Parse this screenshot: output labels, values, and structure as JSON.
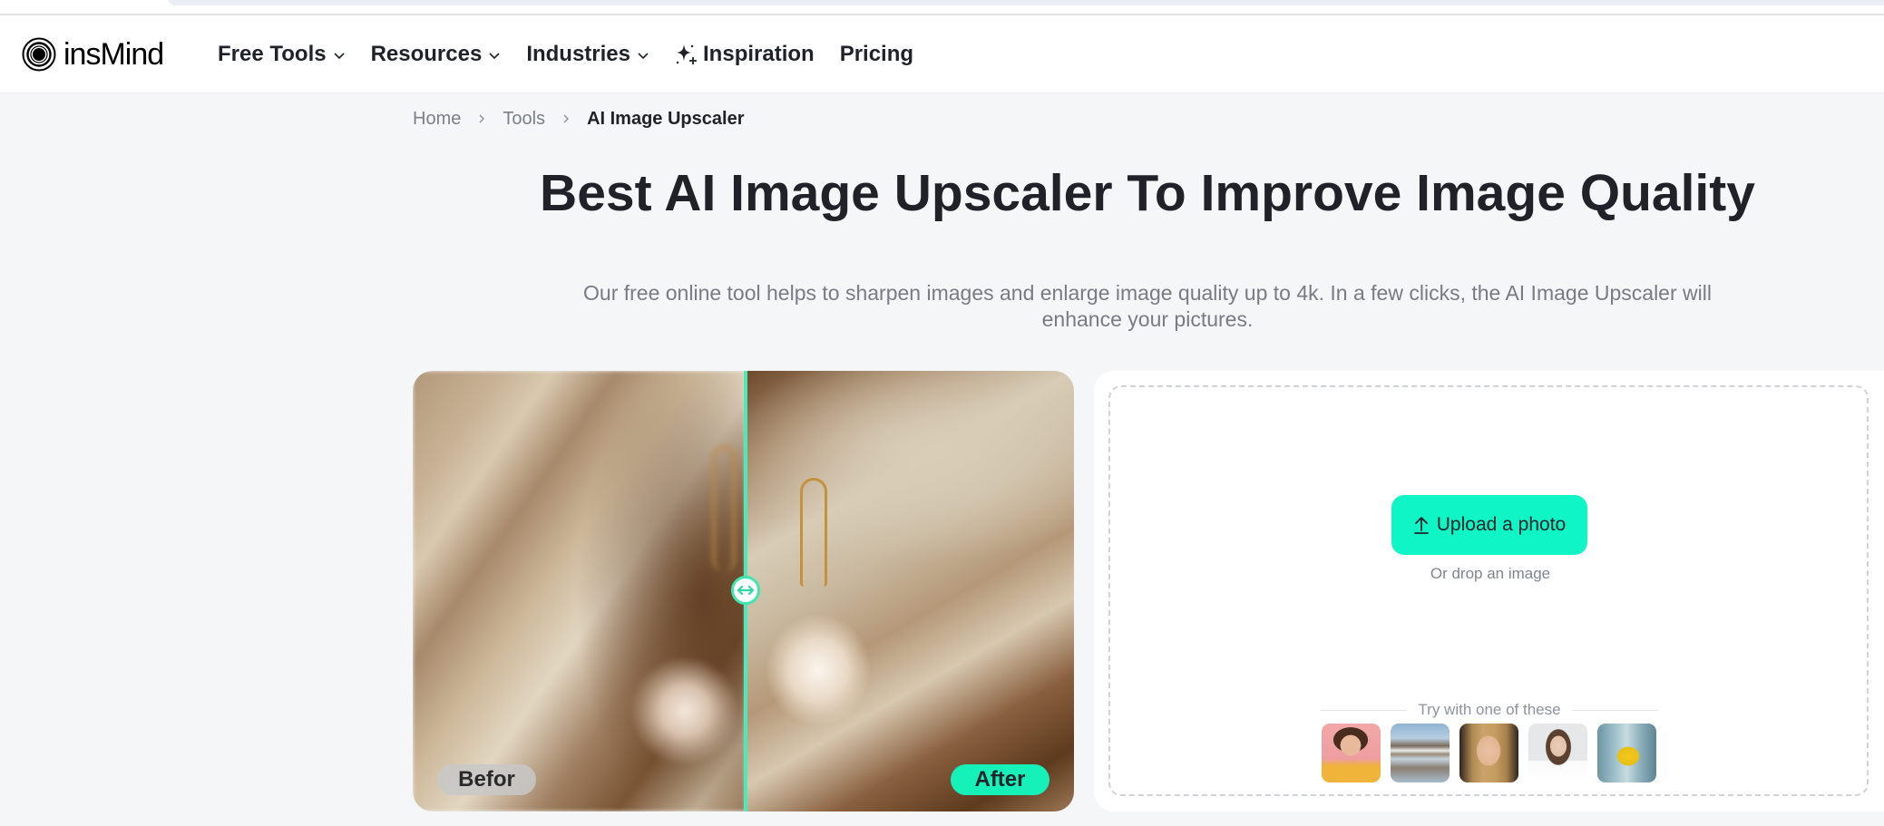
{
  "header": {
    "logo_text": "insMind",
    "nav": [
      {
        "label": "Free Tools",
        "has_dropdown": true
      },
      {
        "label": "Resources",
        "has_dropdown": true
      },
      {
        "label": "Industries",
        "has_dropdown": true
      },
      {
        "label": "Inspiration",
        "icon": "sparkle-icon"
      },
      {
        "label": "Pricing"
      }
    ]
  },
  "breadcrumb": {
    "items": [
      "Home",
      "Tools"
    ],
    "current": "AI Image Upscaler"
  },
  "hero": {
    "title": "Best AI Image Upscaler To Improve Image Quality",
    "subtitle": "Our free online tool helps to sharpen images and enlarge image quality up to 4k. In a few clicks, the AI Image Upscaler will enhance your pictures."
  },
  "comparison": {
    "before_label": "Befor",
    "after_label": "After",
    "slider_position": 0.503,
    "accent_color": "#16f0b9"
  },
  "upload": {
    "button_label": "Upload a photo",
    "button_icon": "upload-icon",
    "drop_text": "Or drop an image",
    "samples_label": "Try with one of these",
    "samples": [
      {
        "name": "smiling woman with phone"
      },
      {
        "name": "mountain lake reflection"
      },
      {
        "name": "woman with wavy hair"
      },
      {
        "name": "woman with sunglasses"
      },
      {
        "name": "yellow handbag"
      }
    ],
    "button_color": "#0ff5c5"
  }
}
